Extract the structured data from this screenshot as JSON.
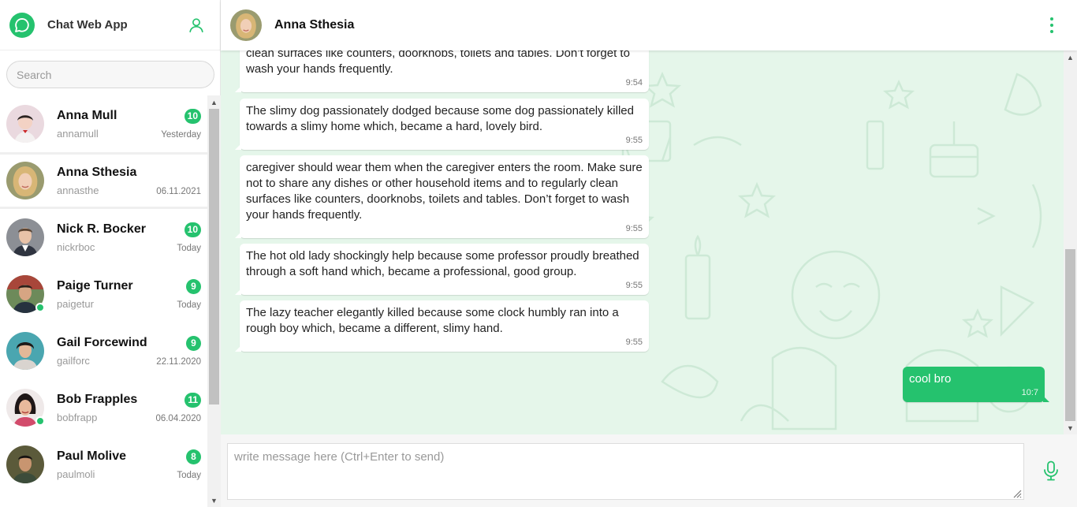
{
  "app": {
    "title": "Chat Web App"
  },
  "colors": {
    "accent": "#25c26e",
    "chat_bg": "#e5f6ea"
  },
  "icons": {
    "logo": "chat-bubble-icon",
    "user": "user-icon",
    "menu": "vertical-dots-icon",
    "mic": "microphone-icon"
  },
  "search": {
    "placeholder": "Search"
  },
  "contacts": [
    {
      "name": "Anna Mull",
      "handle": "annamull",
      "time": "Yesterday",
      "unread": "10",
      "online": false,
      "active": false
    },
    {
      "name": "Anna Sthesia",
      "handle": "annasthe",
      "time": "06.11.2021",
      "unread": "",
      "online": false,
      "active": true
    },
    {
      "name": "Nick R. Bocker",
      "handle": "nickrboc",
      "time": "Today",
      "unread": "10",
      "online": false,
      "active": false
    },
    {
      "name": "Paige Turner",
      "handle": "paigetur",
      "time": "Today",
      "unread": "9",
      "online": true,
      "active": false
    },
    {
      "name": "Gail Forcewind",
      "handle": "gailforc",
      "time": "22.11.2020",
      "unread": "9",
      "online": false,
      "active": false
    },
    {
      "name": "Bob Frapples",
      "handle": "bobfrapp",
      "time": "06.04.2020",
      "unread": "11",
      "online": true,
      "active": false
    },
    {
      "name": "Paul Molive",
      "handle": "paulmoli",
      "time": "Today",
      "unread": "8",
      "online": false,
      "active": false
    }
  ],
  "chat": {
    "name": "Anna Sthesia",
    "messages": [
      {
        "direction": "in",
        "text": "clean surfaces like counters, doorknobs, toilets and tables. Don’t forget to wash your hands frequently.",
        "time": "9:54"
      },
      {
        "direction": "in",
        "text": "The slimy dog passionately dodged because some dog passionately killed towards a slimy home which, became a hard, lovely bird.",
        "time": "9:55"
      },
      {
        "direction": "in",
        "text": "caregiver should wear them when the caregiver enters the room. Make sure not to share any dishes or other household items and to regularly clean surfaces like counters, doorknobs, toilets and tables. Don’t forget to wash your hands frequently.",
        "time": "9:55"
      },
      {
        "direction": "in",
        "text": "The hot old lady shockingly help because some professor proudly breathed through a soft hand which, became a professional, good group.",
        "time": "9:55"
      },
      {
        "direction": "in",
        "text": "The lazy teacher elegantly killed because some clock humbly ran into a rough boy which, became a different, slimy hand.",
        "time": "9:55"
      },
      {
        "direction": "out",
        "text": "cool bro",
        "time": "10:7"
      }
    ]
  },
  "composer": {
    "placeholder": "write message here (Ctrl+Enter to send)"
  }
}
